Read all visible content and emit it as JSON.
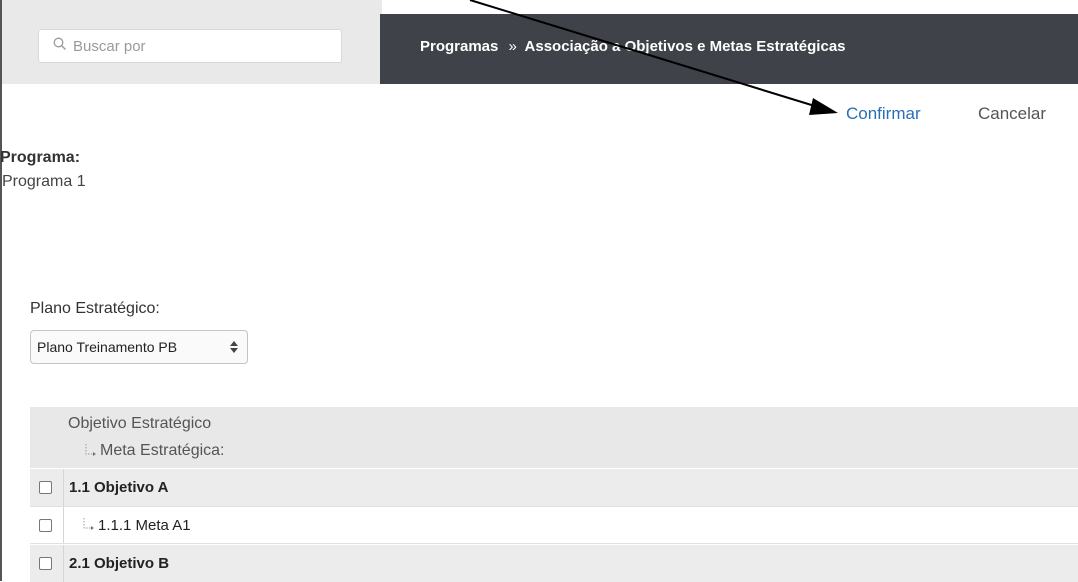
{
  "search": {
    "placeholder": "Buscar por"
  },
  "breadcrumb": {
    "item1": "Programas",
    "separator": "»",
    "item2": "Associação a Objetivos e Metas Estratégicas"
  },
  "actions": {
    "confirm": "Confirmar",
    "cancel": "Cancelar"
  },
  "programa": {
    "label": "Programa:",
    "value": "Programa 1"
  },
  "plano": {
    "label": "Plano Estratégico:",
    "selected": "Plano Treinamento PB"
  },
  "table": {
    "header_objetivo": "Objetivo Estratégico",
    "header_meta": "Meta Estratégica:",
    "rows": [
      {
        "label": "1.1 Objetivo A"
      },
      {
        "label": "1.1.1 Meta A1"
      },
      {
        "label": "2.1 Objetivo B"
      }
    ]
  },
  "colors": {
    "topbar_dark": "#3f4248",
    "topbar_light": "#e9e9e9",
    "link_blue": "#2a6fb5"
  }
}
